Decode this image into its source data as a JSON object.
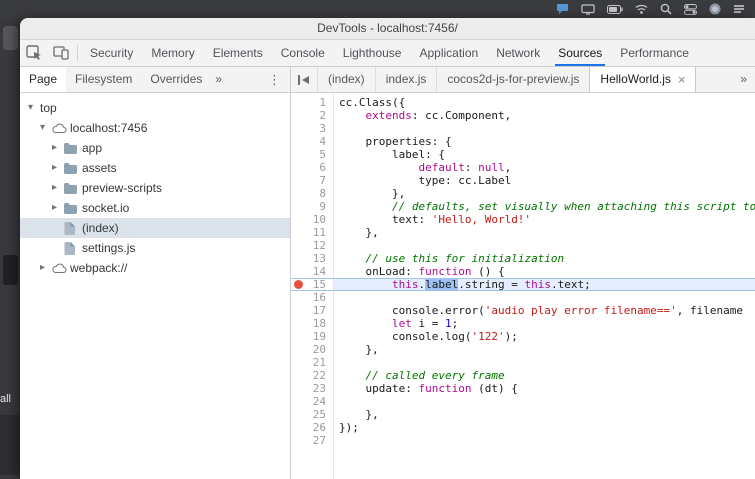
{
  "window": {
    "title": "DevTools - localhost:7456/"
  },
  "left_strip": {
    "partial_text": "all"
  },
  "icons": {
    "tri_open": "▾",
    "tri_closed": "▸",
    "overflow": "»",
    "menu_dots": "⋮",
    "close": "×"
  },
  "toolbar": {
    "tabs": [
      "Security",
      "Memory",
      "Elements",
      "Console",
      "Lighthouse",
      "Application",
      "Network",
      "Sources",
      "Performance"
    ],
    "active_tab": "Sources"
  },
  "sidebar": {
    "tabs": [
      "Page",
      "Filesystem",
      "Overrides"
    ],
    "active_tab": "Page",
    "tree": [
      {
        "label": "top",
        "depth": 0,
        "state": "open",
        "icon": "none"
      },
      {
        "label": "localhost:7456",
        "depth": 1,
        "state": "open",
        "icon": "cloud"
      },
      {
        "label": "app",
        "depth": 2,
        "state": "closed",
        "icon": "folder"
      },
      {
        "label": "assets",
        "depth": 2,
        "state": "closed",
        "icon": "folder"
      },
      {
        "label": "preview-scripts",
        "depth": 2,
        "state": "closed",
        "icon": "folder"
      },
      {
        "label": "socket.io",
        "depth": 2,
        "state": "closed",
        "icon": "folder"
      },
      {
        "label": "(index)",
        "depth": 2,
        "state": "leaf",
        "icon": "file",
        "selected": true
      },
      {
        "label": "settings.js",
        "depth": 2,
        "state": "leaf",
        "icon": "file"
      },
      {
        "label": "webpack://",
        "depth": 1,
        "state": "closed",
        "icon": "cloud"
      }
    ]
  },
  "editor": {
    "tabs": [
      "(index)",
      "index.js",
      "cocos2d-js-for-preview.js",
      "HelloWorld.js"
    ],
    "active_tab": "HelloWorld.js",
    "breakpoint_line": 15,
    "highlight_line": 15,
    "selected_word": "label",
    "lines": [
      {
        "n": 1,
        "tokens": [
          {
            "t": "cc.Class({"
          }
        ]
      },
      {
        "n": 2,
        "tokens": [
          {
            "t": "    "
          },
          {
            "t": "extends",
            "c": "keyword"
          },
          {
            "t": ": cc.Component,"
          }
        ]
      },
      {
        "n": 3,
        "tokens": []
      },
      {
        "n": 4,
        "tokens": [
          {
            "t": "    properties: {"
          }
        ]
      },
      {
        "n": 5,
        "tokens": [
          {
            "t": "        label: {"
          }
        ]
      },
      {
        "n": 6,
        "tokens": [
          {
            "t": "            "
          },
          {
            "t": "default",
            "c": "keyword"
          },
          {
            "t": ": "
          },
          {
            "t": "null",
            "c": "atom"
          },
          {
            "t": ","
          }
        ]
      },
      {
        "n": 7,
        "tokens": [
          {
            "t": "            type: cc.Label"
          }
        ]
      },
      {
        "n": 8,
        "tokens": [
          {
            "t": "        },"
          }
        ]
      },
      {
        "n": 9,
        "tokens": [
          {
            "t": "        "
          },
          {
            "t": "// defaults, set visually when attaching this script to the Canvas",
            "c": "comment"
          }
        ]
      },
      {
        "n": 10,
        "tokens": [
          {
            "t": "        text: "
          },
          {
            "t": "'Hello, World!'",
            "c": "string"
          }
        ]
      },
      {
        "n": 11,
        "tokens": [
          {
            "t": "    },"
          }
        ]
      },
      {
        "n": 12,
        "tokens": []
      },
      {
        "n": 13,
        "tokens": [
          {
            "t": "    "
          },
          {
            "t": "// use this for initialization",
            "c": "comment"
          }
        ]
      },
      {
        "n": 14,
        "tokens": [
          {
            "t": "    onLoad: "
          },
          {
            "t": "function",
            "c": "keyword"
          },
          {
            "t": " () {"
          }
        ]
      },
      {
        "n": 15,
        "tokens": [
          {
            "t": "        "
          },
          {
            "t": "this",
            "c": "keyword"
          },
          {
            "t": "."
          },
          {
            "t": "label",
            "c": "selected"
          },
          {
            "t": ".string = "
          },
          {
            "t": "this",
            "c": "keyword"
          },
          {
            "t": ".text;"
          }
        ]
      },
      {
        "n": 16,
        "tokens": []
      },
      {
        "n": 17,
        "tokens": [
          {
            "t": "        console.error("
          },
          {
            "t": "'audio play error filename=='",
            "c": "string"
          },
          {
            "t": ", filename"
          }
        ]
      },
      {
        "n": 18,
        "tokens": [
          {
            "t": "        "
          },
          {
            "t": "let",
            "c": "keyword"
          },
          {
            "t": " i = "
          },
          {
            "t": "1",
            "c": "number"
          },
          {
            "t": ";"
          }
        ]
      },
      {
        "n": 19,
        "tokens": [
          {
            "t": "        console.log("
          },
          {
            "t": "'122'",
            "c": "string"
          },
          {
            "t": ");"
          }
        ]
      },
      {
        "n": 20,
        "tokens": [
          {
            "t": "    },"
          }
        ]
      },
      {
        "n": 21,
        "tokens": []
      },
      {
        "n": 22,
        "tokens": [
          {
            "t": "    "
          },
          {
            "t": "// called every frame",
            "c": "comment"
          }
        ]
      },
      {
        "n": 23,
        "tokens": [
          {
            "t": "    update: "
          },
          {
            "t": "function",
            "c": "keyword"
          },
          {
            "t": " (dt) {"
          }
        ]
      },
      {
        "n": 24,
        "tokens": []
      },
      {
        "n": 25,
        "tokens": [
          {
            "t": "    },"
          }
        ]
      },
      {
        "n": 26,
        "tokens": [
          {
            "t": "});"
          }
        ]
      },
      {
        "n": 27,
        "tokens": []
      }
    ]
  },
  "colors": {
    "accent": "#1a73e8",
    "breakpoint": "#e8513f",
    "keyword": "#aa0d91",
    "string": "#c41a16",
    "comment": "#007400",
    "number": "#1c00cf",
    "selection": "#9dc1f0",
    "highlight_line_bg": "#e4eefc",
    "selected_tree_row_bg": "#dce2e9"
  }
}
